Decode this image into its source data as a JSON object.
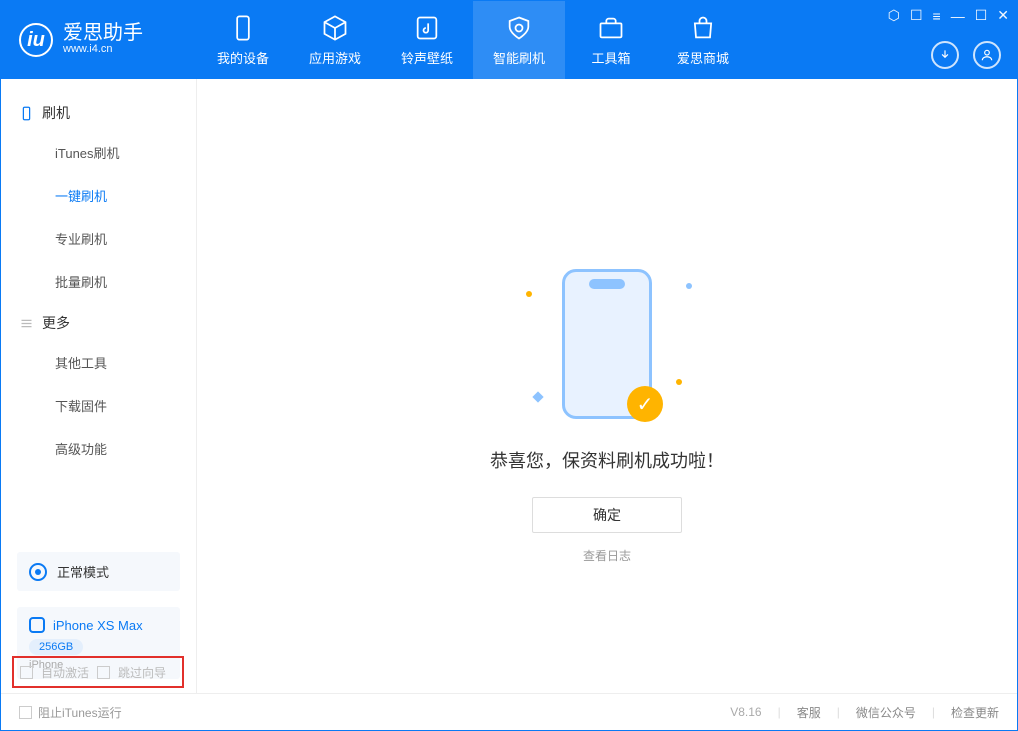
{
  "logo": {
    "cn": "爱思助手",
    "en": "www.i4.cn"
  },
  "nav": {
    "items": [
      {
        "label": "我的设备"
      },
      {
        "label": "应用游戏"
      },
      {
        "label": "铃声壁纸"
      },
      {
        "label": "智能刷机"
      },
      {
        "label": "工具箱"
      },
      {
        "label": "爱思商城"
      }
    ]
  },
  "sidebar": {
    "group1": "刷机",
    "group1_items": [
      "iTunes刷机",
      "一键刷机",
      "专业刷机",
      "批量刷机"
    ],
    "group2": "更多",
    "group2_items": [
      "其他工具",
      "下载固件",
      "高级功能"
    ]
  },
  "mode": {
    "label": "正常模式"
  },
  "device": {
    "name": "iPhone XS Max",
    "capacity": "256GB",
    "type": "iPhone"
  },
  "main": {
    "success": "恭喜您，保资料刷机成功啦！",
    "ok": "确定",
    "view_log": "查看日志"
  },
  "bottom": {
    "auto_activate": "自动激活",
    "skip_guide": "跳过向导"
  },
  "footer": {
    "block_itunes": "阻止iTunes运行",
    "version": "V8.16",
    "service": "客服",
    "wechat": "微信公众号",
    "update": "检查更新"
  }
}
